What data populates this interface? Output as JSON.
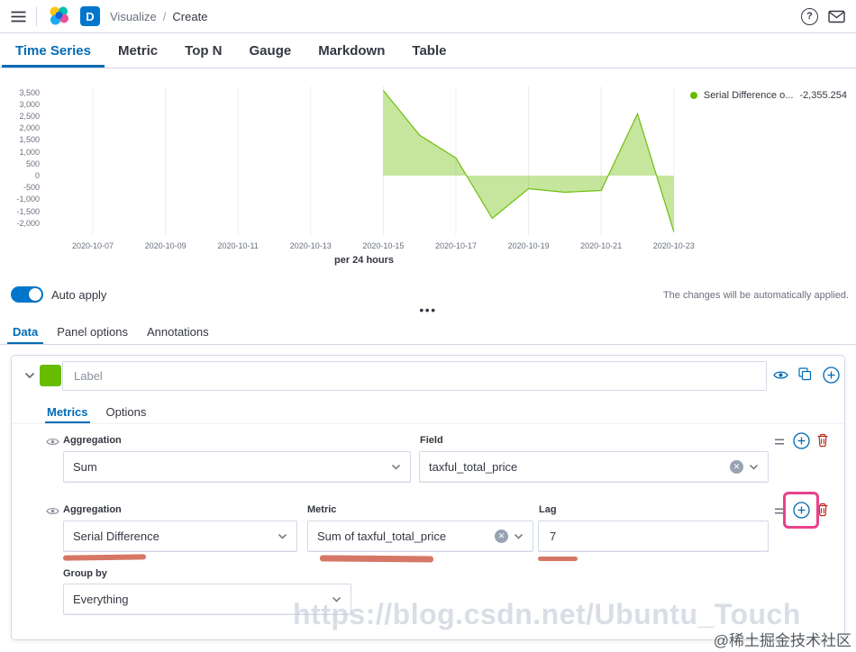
{
  "colors": {
    "accent_blue": "#006BB4",
    "series_green": "#68BC00",
    "danger_red": "#BD271E",
    "highlight_pink": "#E8428C",
    "annotation_red": "#CF5F4A"
  },
  "header": {
    "app_badge": "D",
    "breadcrumb": {
      "section": "Visualize",
      "separator": "/",
      "current": "Create"
    }
  },
  "viz_tabs": [
    {
      "label": "Time Series",
      "active": true
    },
    {
      "label": "Metric",
      "active": false
    },
    {
      "label": "Top N",
      "active": false
    },
    {
      "label": "Gauge",
      "active": false
    },
    {
      "label": "Markdown",
      "active": false
    },
    {
      "label": "Table",
      "active": false
    }
  ],
  "chart_data": {
    "type": "area",
    "title": "",
    "xlabel": "per 24 hours",
    "ylabel": "",
    "ylim": [
      -2500,
      3750
    ],
    "grid": "vertical",
    "legend_position": "top-right",
    "series": [
      {
        "name": "Serial Difference o...",
        "legend_value": "-2,355.254",
        "color": "#68BC00",
        "x": [
          "2020-10-15",
          "2020-10-16",
          "2020-10-17",
          "2020-10-18",
          "2020-10-19",
          "2020-10-20",
          "2020-10-21",
          "2020-10-22",
          "2020-10-23"
        ],
        "values": [
          3580,
          1700,
          740,
          -1800,
          -550,
          -700,
          -625,
          2600,
          -2355.254
        ]
      }
    ],
    "x_ticks": [
      "2020-10-07",
      "2020-10-09",
      "2020-10-11",
      "2020-10-13",
      "2020-10-15",
      "2020-10-17",
      "2020-10-19",
      "2020-10-21",
      "2020-10-23"
    ],
    "y_ticks": [
      "3,500",
      "3,000",
      "2,500",
      "2,000",
      "1,500",
      "1,000",
      "500",
      "0",
      "-500",
      "-1,000",
      "-1,500",
      "-2,000"
    ]
  },
  "apply_bar": {
    "toggle_label": "Auto apply",
    "enabled": true,
    "hint": "The changes will be automatically applied."
  },
  "panel_tabs": [
    {
      "label": "Data",
      "active": true
    },
    {
      "label": "Panel options",
      "active": false
    },
    {
      "label": "Annotations",
      "active": false
    }
  ],
  "series_editor": {
    "label_placeholder": "Label",
    "tabs": [
      {
        "label": "Metrics",
        "active": true
      },
      {
        "label": "Options",
        "active": false
      }
    ],
    "row1": {
      "agg_label": "Aggregation",
      "agg_value": "Sum",
      "field_label": "Field",
      "field_value": "taxful_total_price"
    },
    "row2": {
      "agg_label": "Aggregation",
      "agg_value": "Serial Difference",
      "metric_label": "Metric",
      "metric_value": "Sum of taxful_total_price",
      "lag_label": "Lag",
      "lag_value": "7"
    },
    "group_by": {
      "label": "Group by",
      "value": "Everything"
    }
  },
  "watermark": {
    "url_text": "https://blog.csdn.net/Ubuntu_Touch",
    "credit_text": "@稀土掘金技术社区"
  },
  "icons": {
    "question": "?",
    "clear": "✕",
    "ellipsis_handle": "•••"
  }
}
